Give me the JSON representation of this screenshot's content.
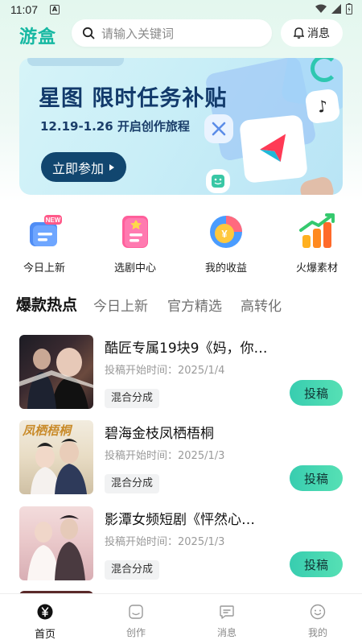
{
  "status_bar": {
    "time": "11:07",
    "badge_letter": "A"
  },
  "header": {
    "logo": "游盒",
    "search_placeholder": "请输入关键词",
    "message_label": "消息"
  },
  "banner": {
    "title": "星图  限时任务补贴",
    "subtitle": "12.19-1.26 开启创作旅程",
    "button_label": "立即参加"
  },
  "quick_links": [
    {
      "label": "今日上新",
      "icon": "new-doc-icon",
      "badge": "NEW"
    },
    {
      "label": "选剧中心",
      "icon": "script-doc-icon"
    },
    {
      "label": "我的收益",
      "icon": "coin-chart-icon",
      "symbol": "¥"
    },
    {
      "label": "火爆素材",
      "icon": "bar-chart-trend-icon"
    }
  ],
  "tabs": [
    {
      "label": "爆款热点",
      "active": true
    },
    {
      "label": "今日上新",
      "active": false
    },
    {
      "label": "官方精选",
      "active": false
    },
    {
      "label": "高转化",
      "active": false
    }
  ],
  "cards": [
    {
      "title": "酷匠专属19块9《妈，你…",
      "date": "投稿开始时间：2025/1/4",
      "tag": "混合分成",
      "button": "投稿"
    },
    {
      "title": "碧海金枝凤栖梧桐",
      "date": "投稿开始时间：2025/1/3",
      "tag": "混合分成",
      "button": "投稿",
      "poster_text": "凤栖梧桐"
    },
    {
      "title": "影潭女频短剧《怦然心…",
      "date": "投稿开始时间：2025/1/3",
      "tag": "混合分成",
      "button": "投稿"
    }
  ],
  "tabbar": [
    {
      "label": "首页",
      "icon": "home-yen-icon",
      "active": true
    },
    {
      "label": "创作",
      "icon": "create-icon",
      "active": false
    },
    {
      "label": "消息",
      "icon": "chat-icon",
      "active": false
    },
    {
      "label": "我的",
      "icon": "profile-smile-icon",
      "active": false
    }
  ],
  "colors": {
    "brand": "#16b8a2",
    "accent_button": "#11466f",
    "submit_button": "#3fd3b2"
  }
}
